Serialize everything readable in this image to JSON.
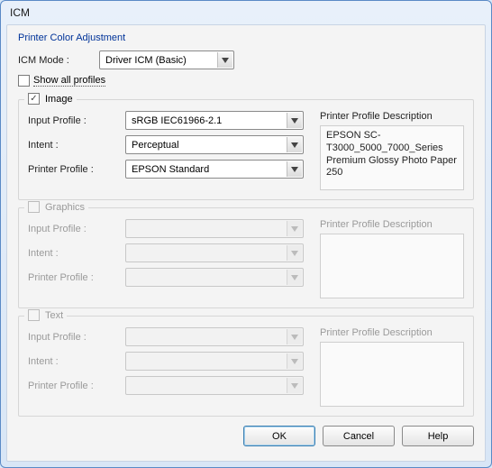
{
  "window": {
    "title": "ICM"
  },
  "header": {
    "section_title": "Printer Color Adjustment"
  },
  "mode": {
    "label": "ICM Mode :",
    "value": "Driver ICM (Basic)"
  },
  "show_all": {
    "label": "Show all profiles",
    "checked": false
  },
  "groups": {
    "image": {
      "title": "Image",
      "checked": true,
      "enabled": true,
      "input_profile": {
        "label": "Input Profile :",
        "value": "sRGB IEC61966-2.1"
      },
      "intent": {
        "label": "Intent :",
        "value": "Perceptual"
      },
      "printer_profile": {
        "label": "Printer Profile :",
        "value": "EPSON Standard"
      },
      "desc_title": "Printer Profile Description",
      "desc_text": "EPSON SC-T3000_5000_7000_Series Premium Glossy Photo Paper 250"
    },
    "graphics": {
      "title": "Graphics",
      "checked": false,
      "enabled": false,
      "input_profile": {
        "label": "Input Profile :",
        "value": ""
      },
      "intent": {
        "label": "Intent :",
        "value": ""
      },
      "printer_profile": {
        "label": "Printer Profile :",
        "value": ""
      },
      "desc_title": "Printer Profile Description",
      "desc_text": ""
    },
    "text": {
      "title": "Text",
      "checked": false,
      "enabled": false,
      "input_profile": {
        "label": "Input Profile :",
        "value": ""
      },
      "intent": {
        "label": "Intent :",
        "value": ""
      },
      "printer_profile": {
        "label": "Printer Profile :",
        "value": ""
      },
      "desc_title": "Printer Profile Description",
      "desc_text": ""
    }
  },
  "buttons": {
    "ok": "OK",
    "cancel": "Cancel",
    "help": "Help"
  }
}
